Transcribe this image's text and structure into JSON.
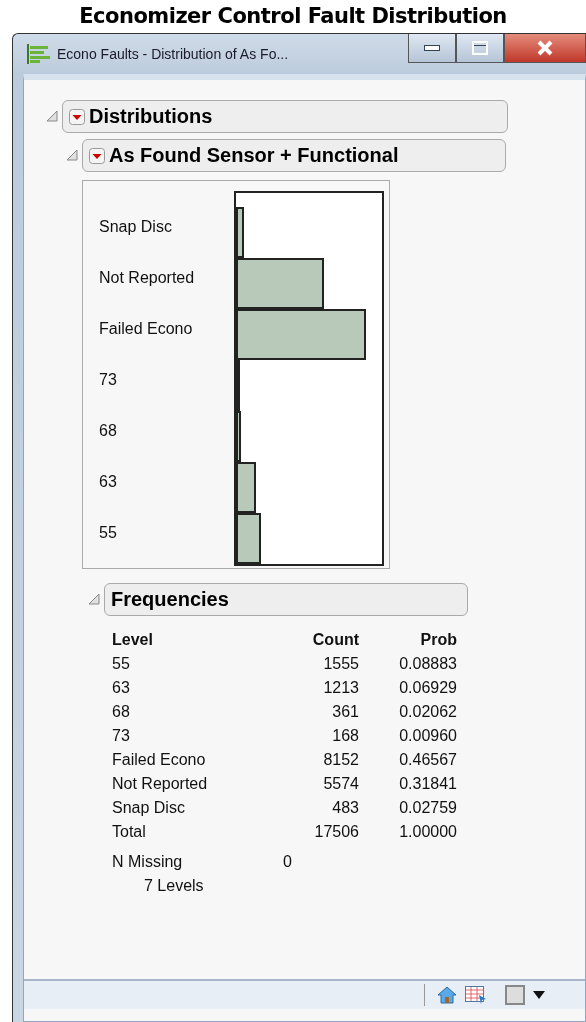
{
  "page_title": "Economizer Control Fault Distribution",
  "window": {
    "title": "Econo Faults - Distribution of As Fo..."
  },
  "outline": {
    "title": "Distributions",
    "expanded": true,
    "report": {
      "title": "As Found Sensor + Functional",
      "expanded": true,
      "bars": [
        {
          "label": "Snap Disc"
        },
        {
          "label": "Not Reported"
        },
        {
          "label": "Failed Econo"
        },
        {
          "label": "73"
        },
        {
          "label": "68"
        },
        {
          "label": "63"
        },
        {
          "label": "55"
        }
      ],
      "frequencies": {
        "title": "Frequencies",
        "expanded": true,
        "columns": [
          "Level",
          "Count",
          "Prob"
        ],
        "rows": [
          [
            "55",
            "1555",
            "0.08883"
          ],
          [
            "63",
            "1213",
            "0.06929"
          ],
          [
            "68",
            "361",
            "0.02062"
          ],
          [
            "73",
            "168",
            "0.00960"
          ],
          [
            "Failed Econo",
            "8152",
            "0.46567"
          ],
          [
            "Not Reported",
            "5574",
            "0.31841"
          ],
          [
            "Snap Disc",
            "483",
            "0.02759"
          ],
          [
            "Total",
            "17506",
            "1.00000"
          ]
        ],
        "missing_label": "N Missing",
        "missing_value": "0",
        "levels_text": "7 Levels"
      }
    }
  }
}
